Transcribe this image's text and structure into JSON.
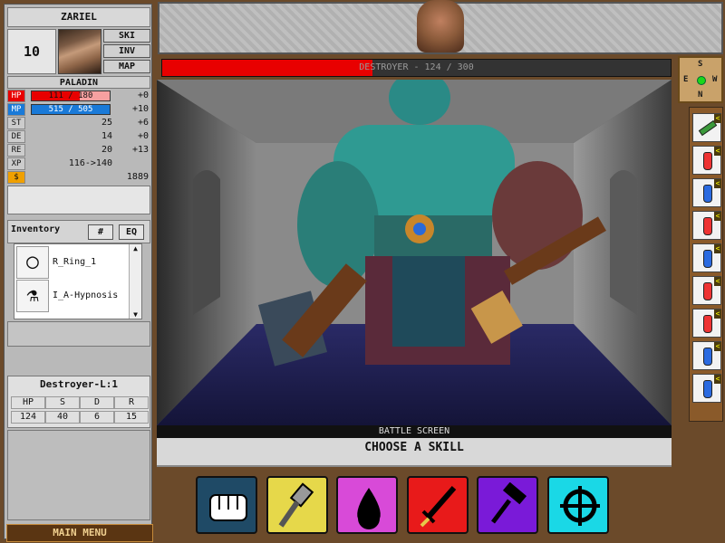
{
  "character": {
    "name": "ZARIEL",
    "level": "10",
    "class": "PALADIN",
    "nav": [
      "SKI",
      "INV",
      "MAP"
    ]
  },
  "stats": {
    "hp": {
      "label": "HP",
      "value": "111 / 180",
      "bonus": "+0",
      "current": 111,
      "max": 180,
      "color": "#e80000"
    },
    "mp": {
      "label": "MP",
      "value": "515 / 505",
      "bonus": "+10",
      "current": 515,
      "max": 505,
      "color": "#1a7ad8"
    },
    "st": {
      "label": "ST",
      "value": "25",
      "bonus": "+6"
    },
    "de": {
      "label": "DE",
      "value": "14",
      "bonus": "+0"
    },
    "re": {
      "label": "RE",
      "value": "20",
      "bonus": "+13"
    },
    "xp": {
      "label": "XP",
      "value": "116->140"
    },
    "gold": {
      "label": "$",
      "value": "1889"
    }
  },
  "inventory": {
    "title": "Inventory",
    "btn_sort": "#",
    "btn_eq": "EQ",
    "items": [
      {
        "name": "R_Ring_1",
        "icon": "ring-icon"
      },
      {
        "name": "I_A-Hypnosis",
        "icon": "potion-flask-icon"
      }
    ]
  },
  "enemy_panel": {
    "title": "Destroyer-L:1",
    "headers": [
      "HP",
      "S",
      "D",
      "R"
    ],
    "values": [
      "124",
      "40",
      "6",
      "15"
    ]
  },
  "main_menu": "MAIN MENU",
  "enemy_bar": {
    "text": "DESTROYER - 124 / 300",
    "current": 124,
    "max": 300,
    "color": "#e80000"
  },
  "compass": {
    "n": "N",
    "s": "S",
    "e": "E",
    "w": "W"
  },
  "potions": [
    {
      "type": "scroll-icon",
      "color": "#3a9a3a"
    },
    {
      "type": "red-potion-icon",
      "color": "#e33"
    },
    {
      "type": "blue-potion-icon",
      "color": "#2a6ae0"
    },
    {
      "type": "red-potion-icon",
      "color": "#e33"
    },
    {
      "type": "blue-potion-icon",
      "color": "#2a6ae0"
    },
    {
      "type": "red-potion-icon",
      "color": "#e33"
    },
    {
      "type": "red-potion-icon",
      "color": "#e33"
    },
    {
      "type": "blue-potion-icon",
      "color": "#2a6ae0"
    },
    {
      "type": "blue-potion-icon",
      "color": "#2a6ae0"
    }
  ],
  "battle": {
    "screen_label": "BATTLE SCREEN",
    "prompt": "CHOOSE A SKILL"
  },
  "skills": [
    {
      "name": "punch-skill-icon",
      "bg": "#1f4a66"
    },
    {
      "name": "mace-skill-icon",
      "bg": "#e6d84a"
    },
    {
      "name": "blood-drop-skill-icon",
      "bg": "#d84ad8"
    },
    {
      "name": "dagger-skill-icon",
      "bg": "#e81a1a"
    },
    {
      "name": "hammer-skill-icon",
      "bg": "#7a1ad8"
    },
    {
      "name": "target-skill-icon",
      "bg": "#1ad8e6"
    }
  ]
}
